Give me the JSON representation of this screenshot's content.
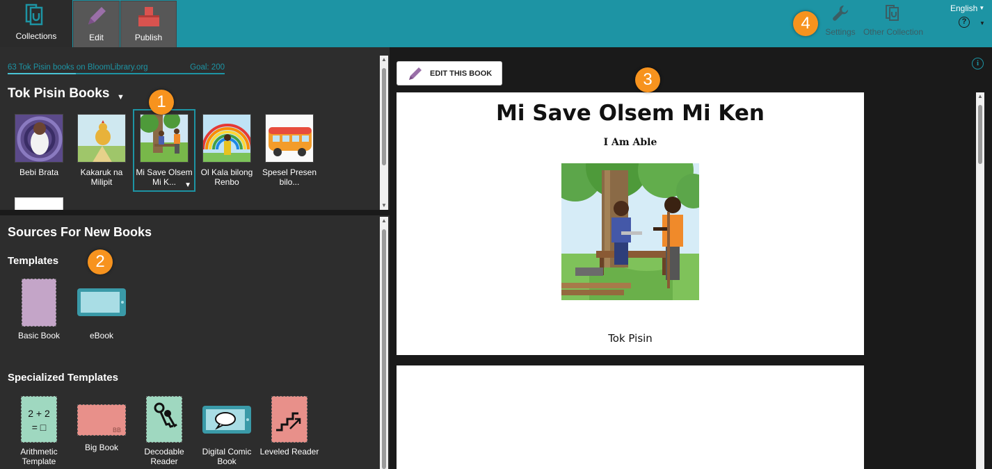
{
  "topbar": {
    "tabs": [
      {
        "label": "Collections",
        "icon": "collections-icon",
        "active": true
      },
      {
        "label": "Edit",
        "icon": "pencil-icon",
        "active": false
      },
      {
        "label": "Publish",
        "icon": "publish-icon",
        "active": false
      }
    ],
    "settings_label": "Settings",
    "other_collection_label": "Other Collection",
    "language": "English",
    "help_symbol": "?"
  },
  "callouts": [
    "1",
    "2",
    "3",
    "4"
  ],
  "collection": {
    "books_on_library": "63 Tok Pisin books on BloomLibrary.org",
    "goal": "Goal: 200",
    "goal_progress": 0.315,
    "title": "Tok Pisin Books",
    "books": [
      {
        "title": "Bebi Brata"
      },
      {
        "title": "Kakaruk na Milipit"
      },
      {
        "title": "Mi Save Olsem Mi K...",
        "selected": true
      },
      {
        "title": "Ol Kala bilong Renbo"
      },
      {
        "title": "Spesel Presen bilo..."
      }
    ]
  },
  "sources": {
    "title": "Sources For New Books",
    "templates_heading": "Templates",
    "templates": [
      {
        "label": "Basic Book"
      },
      {
        "label": "eBook"
      }
    ],
    "specialized_heading": "Specialized Templates",
    "specialized": [
      {
        "label": "Arithmetic Template",
        "glyph_top": "2 + 2",
        "glyph_bottom": "= □"
      },
      {
        "label": "Big Book",
        "glyph": "BB"
      },
      {
        "label": "Decodable Reader"
      },
      {
        "label": "Digital Comic Book"
      },
      {
        "label": "Leveled Reader"
      }
    ]
  },
  "preview": {
    "edit_button_label": "EDIT THIS BOOK",
    "info_symbol": "i",
    "book_title": "Mi Save Olsem Mi Ken",
    "book_subtitle": "I Am Able",
    "book_language": "Tok Pisin"
  },
  "colors": {
    "accent": "#1d94a4",
    "callout": "#f7931e",
    "panel": "#2d2d2d",
    "edit_purple": "#9a6fa8",
    "publish_red": "#d9534f"
  }
}
